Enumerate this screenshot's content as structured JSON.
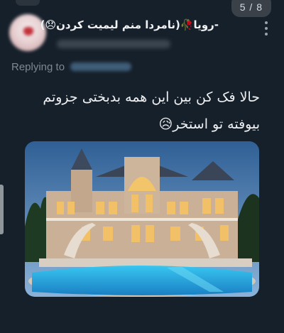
{
  "pager": {
    "label": "5 / 8"
  },
  "author": {
    "display_name": "-رویا🥀(نامردا منم لیمیت کردن😞)"
  },
  "reply": {
    "prefix": "Replying to"
  },
  "tweet": {
    "line1": "حالا فک کن بین این همه بدبختی جزوتم",
    "line2": "بیوفته تو استخر😥"
  },
  "icons": {
    "more": "more-vertical-icon"
  }
}
